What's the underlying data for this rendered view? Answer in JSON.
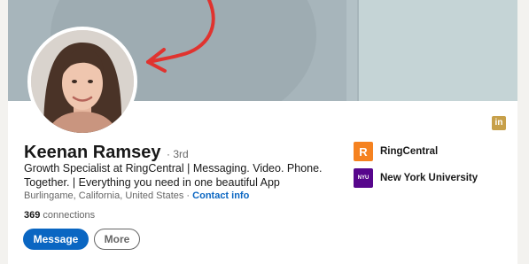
{
  "profile": {
    "name": "Keenan Ramsey",
    "degree": "· 3rd",
    "headline": "Growth Specialist at RingCentral | Messaging. Video. Phone. Together. | Everything you need in one beautiful App",
    "location": "Burlingame, California, United States ·",
    "contact_link": "Contact info",
    "connections_count": "369",
    "connections_label": "connections"
  },
  "actions": {
    "message_label": "Message",
    "more_label": "More"
  },
  "experience": [
    {
      "name": "RingCentral",
      "logo_letter": "R",
      "logo_color": "#f58220"
    },
    {
      "name": "New York University",
      "logo_letter": "NYU",
      "logo_color": "#57068c"
    }
  ],
  "brand_icon": {
    "icon": "linkedin-icon",
    "glyph": "in",
    "color": "#c7a04a"
  },
  "colors": {
    "accent": "#0a66c2",
    "annotation_arrow": "#e0332f",
    "cover": "#a7b5bb"
  }
}
